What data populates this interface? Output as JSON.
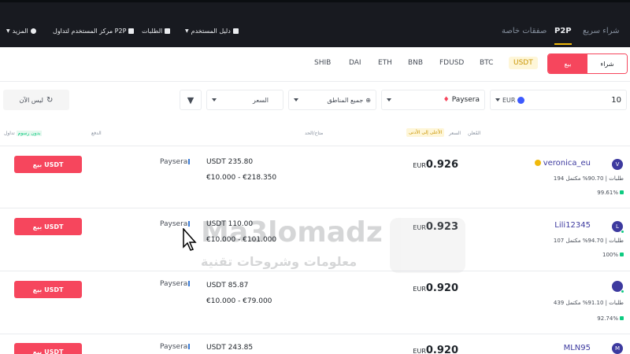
{
  "topbar": {
    "nav_express": "شراء سريع",
    "nav_p2p": "P2P",
    "nav_block": "صفقات خاصة",
    "more": "المزيد",
    "center": "مركز المستخدم لتداول P2P",
    "orders": "الطلبات",
    "guide": "دليل المستخدم"
  },
  "trade_toggle": {
    "buy_label": "شراء",
    "sell_label": "بيع"
  },
  "coins": [
    "USDT",
    "BTC",
    "FDUSD",
    "BNB",
    "ETH",
    "DAI",
    "SHIB"
  ],
  "active_coin": "USDT",
  "filters": {
    "amount_value": "10",
    "currency": "EUR",
    "payment": "Paysera",
    "regions": "جميع المناطق",
    "sort": "السعر",
    "refresh": "ليس الآن"
  },
  "table_headers": {
    "advertiser": "المُعلن",
    "price": "السعر",
    "lowest_badge": "الأعلى إلى الأدنى",
    "limits": "متاح/الحد",
    "payment": "الدفع",
    "trade": "تداول",
    "zero_fee": "بدون رسوم"
  },
  "rows": [
    {
      "avatar": "V",
      "name": "veronica_eu",
      "verified": true,
      "orders": "194 طلبات",
      "completion": "90.70% مكتمل",
      "rating": "99.61%",
      "price": "0.926",
      "currency": "EUR",
      "available": "USDT 235.80",
      "limit": "€10.000 - €218.350",
      "payment": "Paysera",
      "button": "بيع USDT"
    },
    {
      "avatar": "L",
      "name": "Lili12345",
      "verified": false,
      "orders": "107 طلبات",
      "completion": "94.70% مكتمل",
      "rating": "100%",
      "price": "0.923",
      "currency": "EUR",
      "available": "USDT 110.00",
      "limit": "€10.000 - €101.000",
      "payment": "Paysera",
      "button": "بيع USDT"
    },
    {
      "avatar": "",
      "name": "",
      "verified": false,
      "orders": "439 طلبات",
      "completion": "91.10% مكتمل",
      "rating": "92.74%",
      "price": "0.920",
      "currency": "EUR",
      "available": "USDT 85.87",
      "limit": "€10.000 - €79.000",
      "payment": "Paysera",
      "button": "بيع USDT"
    },
    {
      "avatar": "M",
      "name": "MLN95",
      "verified": false,
      "orders": "",
      "completion": "",
      "rating": "",
      "price": "0.920",
      "currency": "EUR",
      "available": "USDT 243.85",
      "limit": "",
      "payment": "Paysera",
      "button": "بيع USDT"
    }
  ],
  "watermark": {
    "title": "Ma3lomadz",
    "subtitle": "معلومات وشروحات تقنية"
  },
  "colors": {
    "sell": "#f6465d",
    "accent": "#f0b90b",
    "topbar": "#181a20"
  }
}
